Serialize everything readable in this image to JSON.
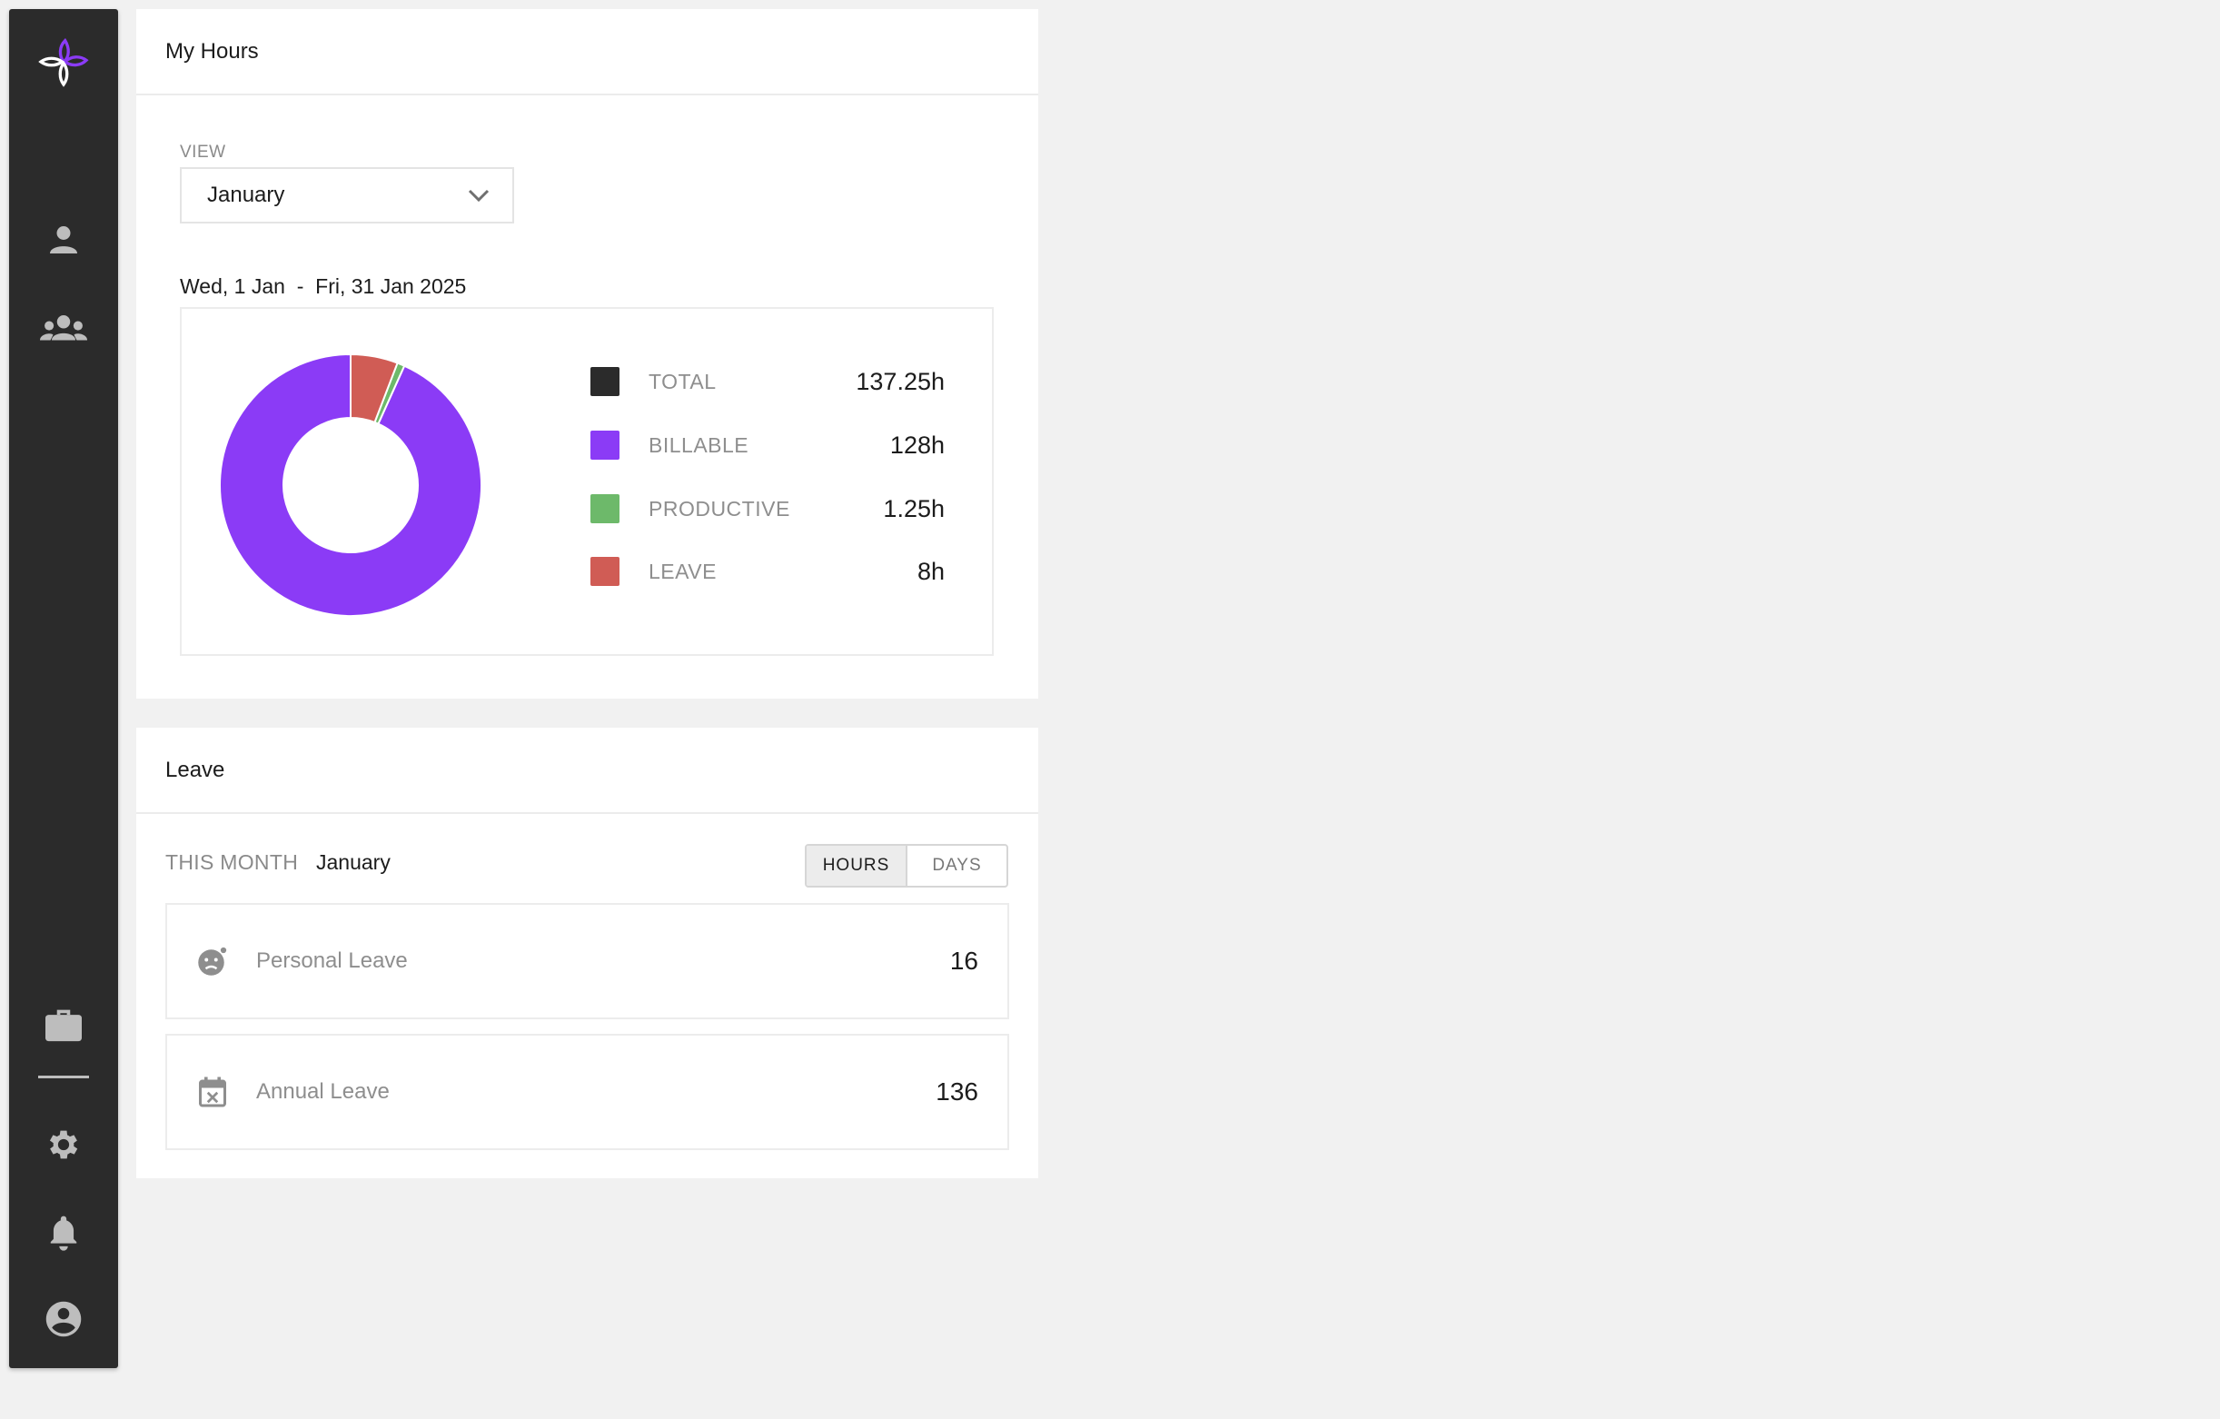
{
  "nav": {
    "items": [
      {
        "icon": "person-icon"
      },
      {
        "icon": "group-icon"
      },
      {
        "icon": "briefcase-icon"
      },
      {
        "icon": "gear-icon"
      },
      {
        "icon": "bell-icon"
      },
      {
        "icon": "account-circle-icon"
      }
    ],
    "brand_colors": {
      "logo_accent": "#8b3bf6",
      "logo_base": "#ffffff"
    }
  },
  "my_hours": {
    "title": "My Hours",
    "view_label": "VIEW",
    "view_value": "January",
    "date_range": "Wed, 1 Jan  -  Fri, 31 Jan 2025"
  },
  "chart_data": {
    "type": "pie",
    "variant": "donut",
    "slices": [
      {
        "label": "BILLABLE",
        "value": 128,
        "color": "#8b3bf6"
      },
      {
        "label": "PRODUCTIVE",
        "value": 1.25,
        "color": "#6db96a"
      },
      {
        "label": "LEAVE",
        "value": 8,
        "color": "#d05c55"
      }
    ]
  },
  "legend": [
    {
      "label": "TOTAL",
      "value": "137.25h",
      "color": "#2b2b2b"
    },
    {
      "label": "BILLABLE",
      "value": "128h",
      "color": "#8b3bf6"
    },
    {
      "label": "PRODUCTIVE",
      "value": "1.25h",
      "color": "#6db96a"
    },
    {
      "label": "LEAVE",
      "value": "8h",
      "color": "#d05c55"
    }
  ],
  "leave": {
    "title": "Leave",
    "period_label": "THIS MONTH",
    "period_value": "January",
    "toggle": {
      "hours": "HOURS",
      "days": "DAYS",
      "selected": "HOURS"
    },
    "items": [
      {
        "name": "Personal Leave",
        "value": "16",
        "icon": "sick-face-icon"
      },
      {
        "name": "Annual Leave",
        "value": "136",
        "icon": "calendar-x-icon"
      }
    ]
  }
}
